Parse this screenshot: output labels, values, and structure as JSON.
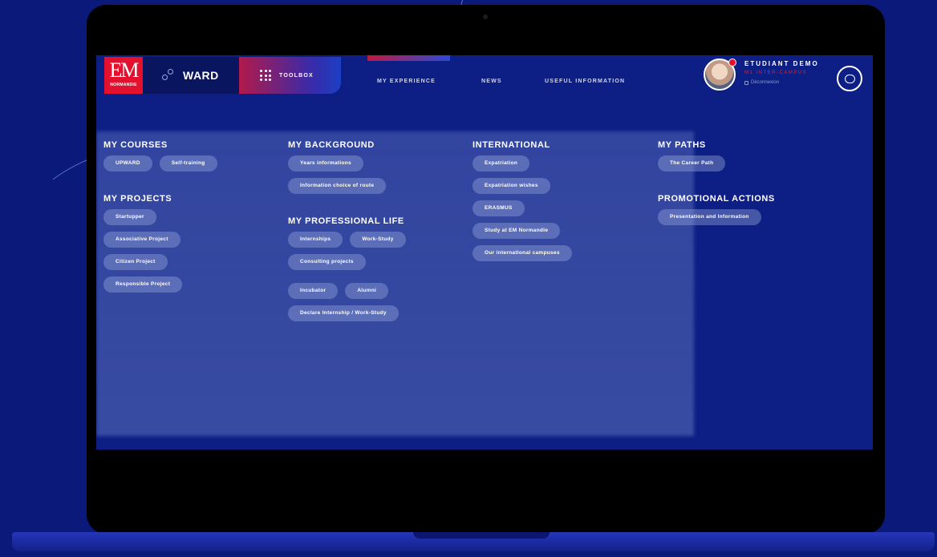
{
  "header": {
    "logo": {
      "main": "EM",
      "sub": "NORMANDIE"
    },
    "ward_label": "WARD",
    "toolbox_label": "TOOLBOX",
    "nav": [
      "MY EXPERIENCE",
      "NEWS",
      "USEFUL INFORMATION"
    ]
  },
  "user": {
    "name": "ETUDIANT DEMO",
    "campus": "M1 INTER-CAMPUS",
    "logout": "Déconnexion"
  },
  "menu": {
    "courses": {
      "title": "MY COURSES",
      "items": [
        "UPWARD",
        "Self-training"
      ]
    },
    "projects": {
      "title": "MY PROJECTS",
      "items": [
        "Startupper",
        "Associative Project",
        "Citizen Project",
        "Responsible Project"
      ]
    },
    "background": {
      "title": "MY BACKGROUND",
      "items": [
        "Years informations",
        "Information choice of route"
      ]
    },
    "professional": {
      "title": "MY PROFESSIONAL LIFE",
      "items": [
        "Internships",
        "Work-Study",
        "Consulting projects",
        "Incubator",
        "Alumni",
        "Declare Internship / Work-Study"
      ]
    },
    "international": {
      "title": "INTERNATIONAL",
      "items": [
        "Expatriation",
        "Expatriation wishes",
        "ERASMUS",
        "Study at EM Normandie",
        "Our international campuses"
      ]
    },
    "paths": {
      "title": "MY PATHS",
      "items": [
        "The Career Path"
      ]
    },
    "promo": {
      "title": "PROMOTIONAL ACTIONS",
      "items": [
        "Presentation and Information"
      ]
    }
  }
}
